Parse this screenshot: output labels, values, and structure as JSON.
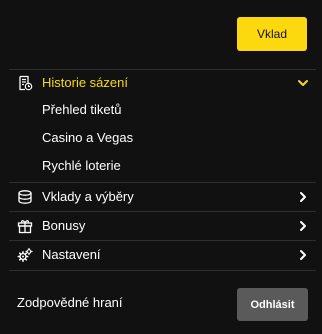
{
  "header": {
    "deposit_label": "Vklad"
  },
  "menu": {
    "betting_history": {
      "label": "Historie sázení",
      "icon": "receipt-clock-icon",
      "expanded": true,
      "items": [
        {
          "label": "Přehled tiketů"
        },
        {
          "label": "Casino a Vegas"
        },
        {
          "label": "Rychlé loterie"
        }
      ]
    },
    "deposits_withdrawals": {
      "label": "Vklady a výběry",
      "icon": "coins-icon"
    },
    "bonuses": {
      "label": "Bonusy",
      "icon": "gift-icon"
    },
    "settings": {
      "label": "Nastavení",
      "icon": "gears-icon"
    }
  },
  "footer": {
    "responsible_gaming_label": "Zodpovědné hraní",
    "logout_label": "Odhlásit"
  },
  "colors": {
    "background": "#111111",
    "accent": "#fcd90f",
    "divider": "#2e2e2e",
    "logout_button": "#5a5a5a",
    "text": "#ffffff"
  }
}
